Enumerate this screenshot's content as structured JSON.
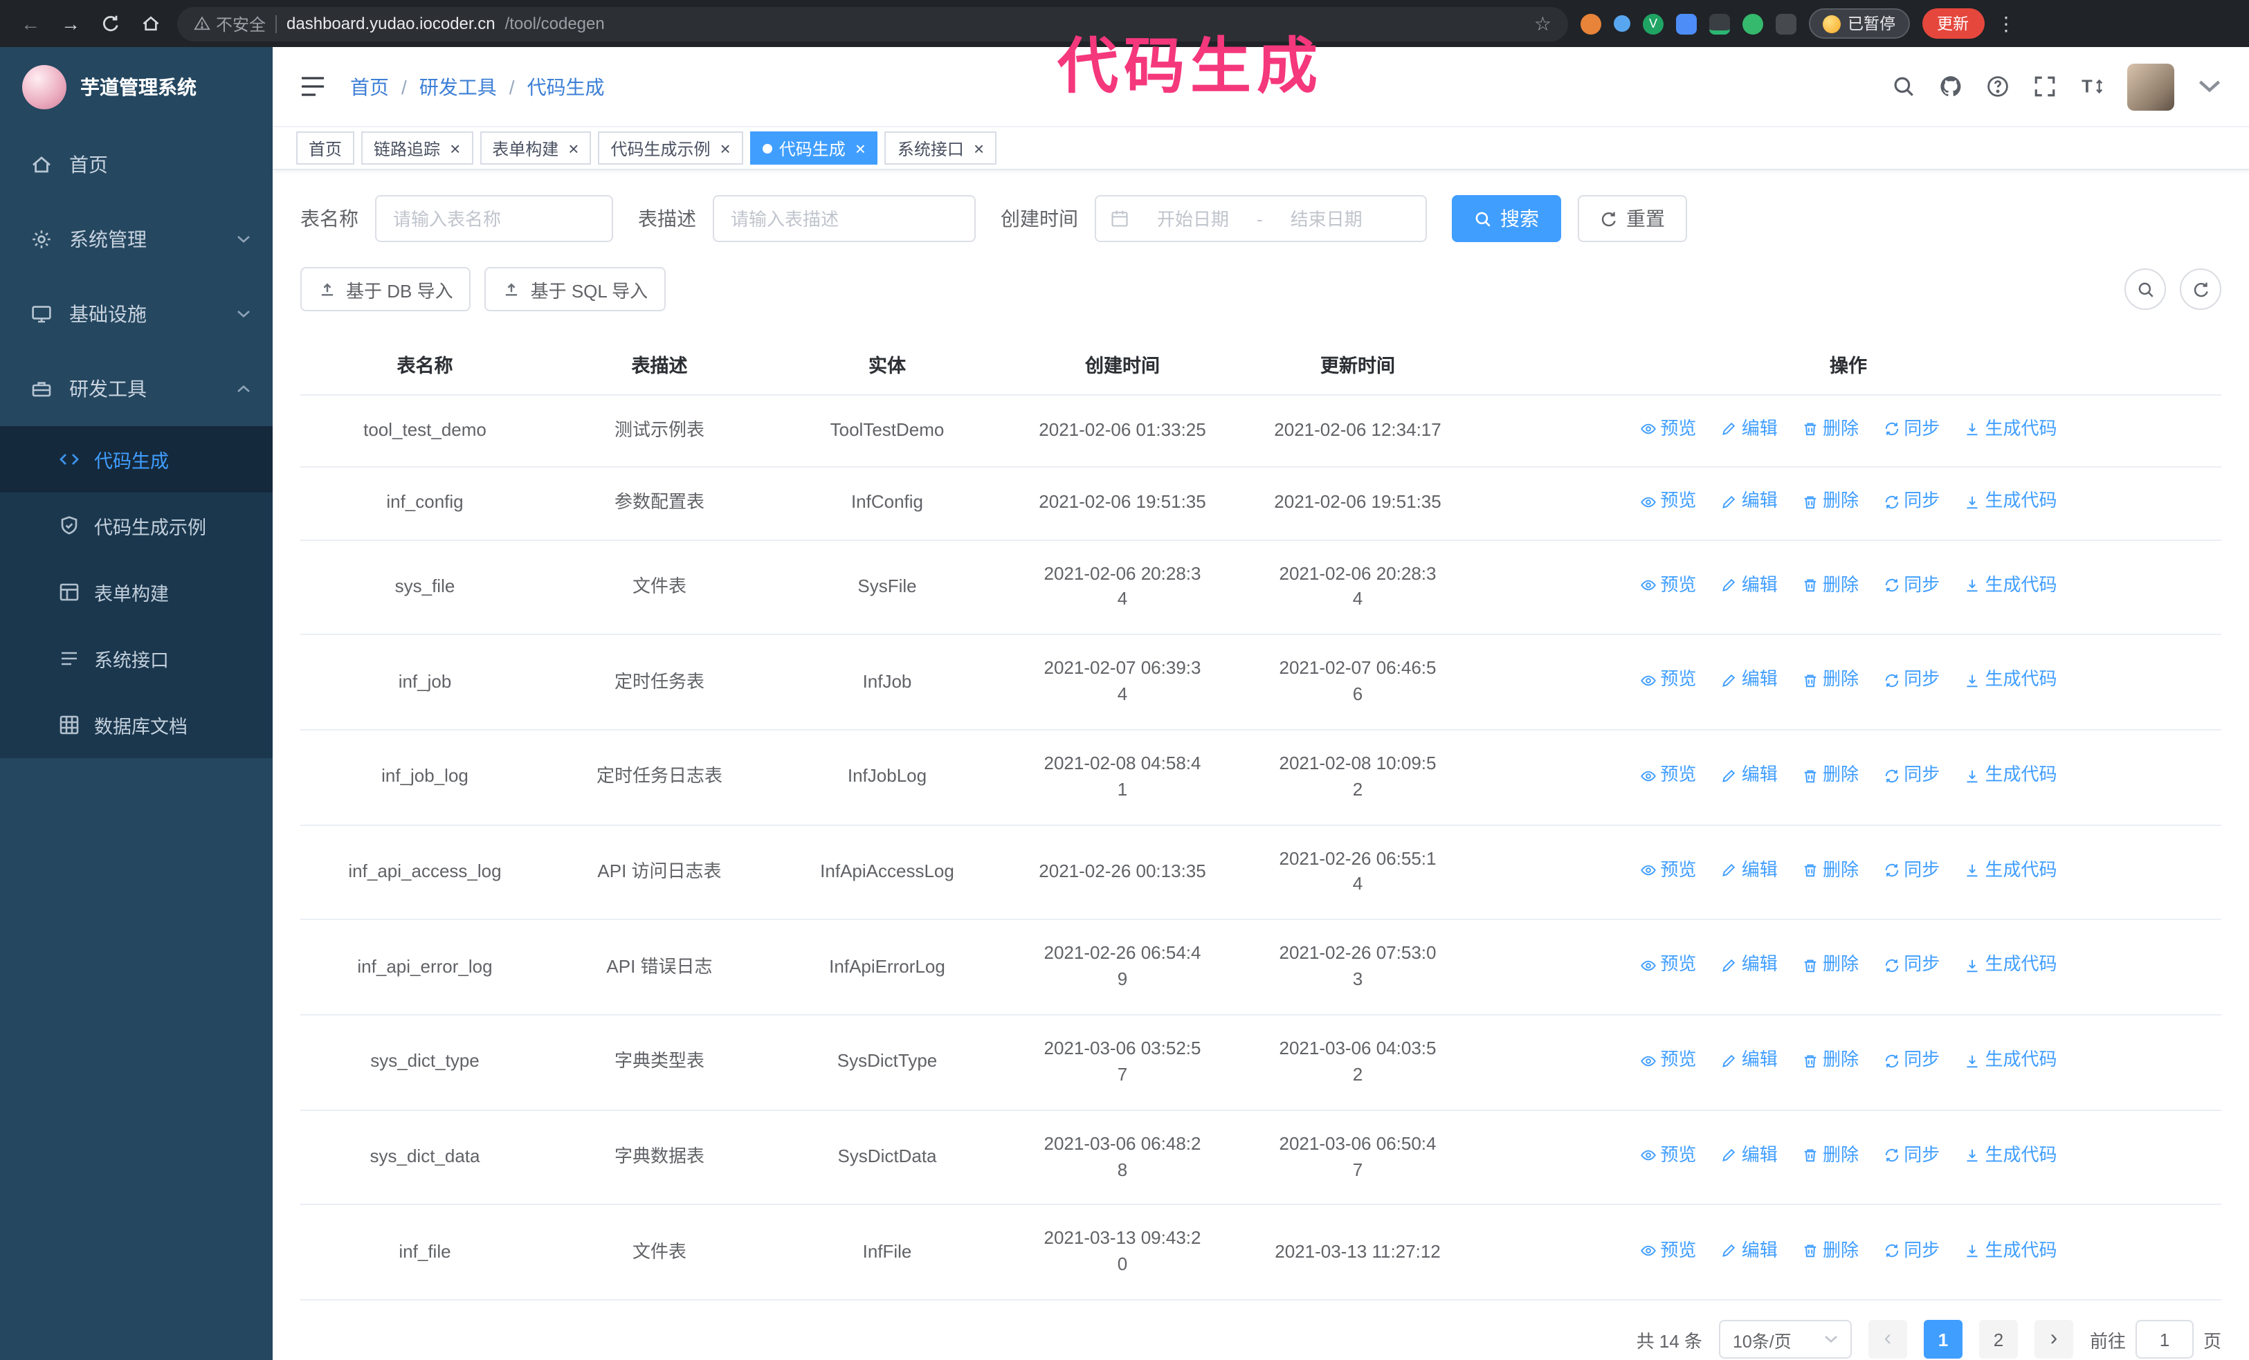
{
  "colors": {
    "accent": "#409eff",
    "annotation_pink": "#f5377c",
    "update_red": "#e5473d",
    "sidebar_bg": "#254760",
    "submenu_bg": "#1a374e"
  },
  "icons": {
    "close": "×",
    "star": "☆",
    "back": "←",
    "forward": "→",
    "kebab": "⋮",
    "prev": "‹",
    "next": "›"
  },
  "browser": {
    "insecure_label": "不安全",
    "url_host": "dashboard.yudao.iocoder.cn",
    "url_path": "/tool/codegen",
    "paused_badge": "已暂停",
    "update_button": "更新"
  },
  "annotation": {
    "text": "代码生成"
  },
  "sidebar": {
    "logo_title": "芋道管理系统",
    "items": [
      {
        "label": "首页"
      },
      {
        "label": "系统管理"
      },
      {
        "label": "基础设施"
      },
      {
        "label": "研发工具"
      }
    ],
    "submenu": [
      {
        "label": "代码生成"
      },
      {
        "label": "代码生成示例"
      },
      {
        "label": "表单构建"
      },
      {
        "label": "系统接口"
      },
      {
        "label": "数据库文档"
      }
    ]
  },
  "header": {
    "breadcrumb": [
      "首页",
      "研发工具",
      "代码生成"
    ]
  },
  "tabs": [
    {
      "label": "首页"
    },
    {
      "label": "链路追踪"
    },
    {
      "label": "表单构建"
    },
    {
      "label": "代码生成示例"
    },
    {
      "label": "代码生成"
    },
    {
      "label": "系统接口"
    }
  ],
  "filters": {
    "name_label": "表名称",
    "name_placeholder": "请输入表名称",
    "desc_label": "表描述",
    "desc_placeholder": "请输入表描述",
    "time_label": "创建时间",
    "start_placeholder": "开始日期",
    "range_separator": "-",
    "end_placeholder": "结束日期",
    "search": "搜索",
    "reset": "重置"
  },
  "toolbar": {
    "import_db": "基于 DB 导入",
    "import_sql": "基于 SQL 导入"
  },
  "table": {
    "columns": [
      "表名称",
      "表描述",
      "实体",
      "创建时间",
      "更新时间",
      "操作"
    ],
    "actions": [
      "预览",
      "编辑",
      "删除",
      "同步",
      "生成代码"
    ],
    "rows": [
      {
        "name": "tool_test_demo",
        "desc": "测试示例表",
        "entity": "ToolTestDemo",
        "create_time": "2021-02-06 01:33:25",
        "update_time": "2021-02-06 12:34:17"
      },
      {
        "name": "inf_config",
        "desc": "参数配置表",
        "entity": "InfConfig",
        "create_time": "2021-02-06 19:51:35",
        "update_time": "2021-02-06 19:51:35"
      },
      {
        "name": "sys_file",
        "desc": "文件表",
        "entity": "SysFile",
        "create_time": "2021-02-06 20:28:3\n4",
        "update_time": "2021-02-06 20:28:3\n4"
      },
      {
        "name": "inf_job",
        "desc": "定时任务表",
        "entity": "InfJob",
        "create_time": "2021-02-07 06:39:3\n4",
        "update_time": "2021-02-07 06:46:5\n6"
      },
      {
        "name": "inf_job_log",
        "desc": "定时任务日志表",
        "entity": "InfJobLog",
        "create_time": "2021-02-08 04:58:4\n1",
        "update_time": "2021-02-08 10:09:5\n2"
      },
      {
        "name": "inf_api_access_log",
        "desc": "API 访问日志表",
        "entity": "InfApiAccessLog",
        "create_time": "2021-02-26 00:13:35",
        "update_time": "2021-02-26 06:55:1\n4"
      },
      {
        "name": "inf_api_error_log",
        "desc": "API 错误日志",
        "entity": "InfApiErrorLog",
        "create_time": "2021-02-26 06:54:4\n9",
        "update_time": "2021-02-26 07:53:0\n3"
      },
      {
        "name": "sys_dict_type",
        "desc": "字典类型表",
        "entity": "SysDictType",
        "create_time": "2021-03-06 03:52:5\n7",
        "update_time": "2021-03-06 04:03:5\n2"
      },
      {
        "name": "sys_dict_data",
        "desc": "字典数据表",
        "entity": "SysDictData",
        "create_time": "2021-03-06 06:48:2\n8",
        "update_time": "2021-03-06 06:50:4\n7"
      },
      {
        "name": "inf_file",
        "desc": "文件表",
        "entity": "InfFile",
        "create_time": "2021-03-13 09:43:2\n0",
        "update_time": "2021-03-13 11:27:12"
      }
    ]
  },
  "pagination": {
    "total": "共 14 条",
    "page_size": "10条/页",
    "pages": [
      "1",
      "2"
    ],
    "goto_label": "前往",
    "goto_value": "1",
    "goto_unit": "页"
  }
}
